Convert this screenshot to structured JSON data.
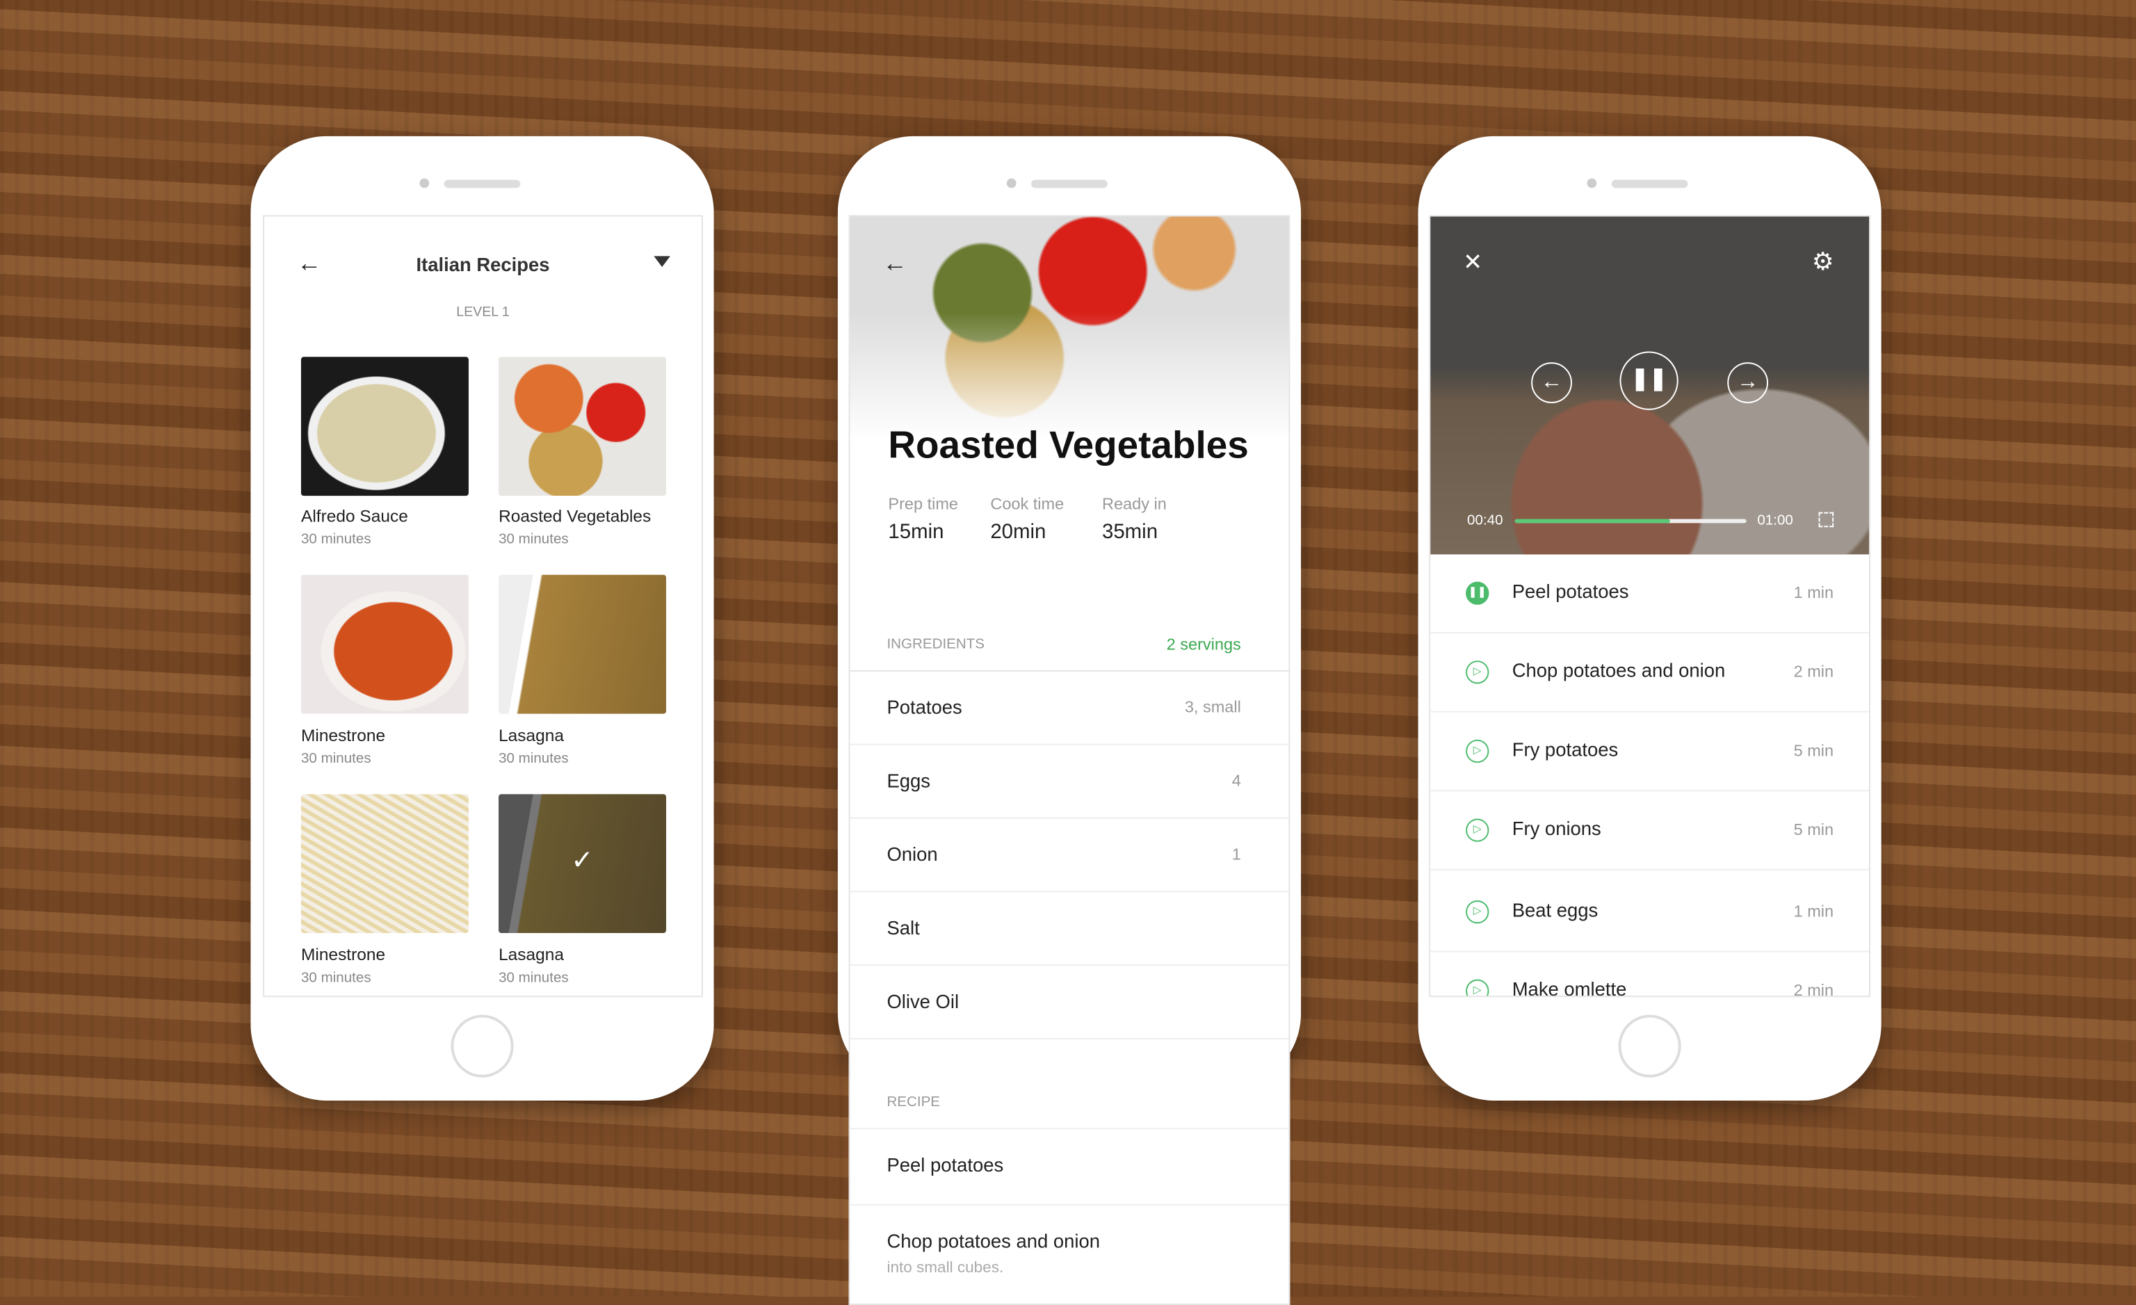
{
  "list_screen": {
    "title": "Italian Recipes",
    "level": "LEVEL 1",
    "recipes": [
      {
        "name": "Alfredo Sauce",
        "time": "30 minutes"
      },
      {
        "name": "Roasted Vegetables",
        "time": "30 minutes"
      },
      {
        "name": "Minestrone",
        "time": "30 minutes"
      },
      {
        "name": "Lasagna",
        "time": "30 minutes"
      },
      {
        "name": "Minestrone",
        "time": "30 minutes"
      },
      {
        "name": "Lasagna",
        "time": "30 minutes",
        "completed": true
      }
    ]
  },
  "detail_screen": {
    "title": "Roasted Vegetables",
    "stats": [
      {
        "label": "Prep time",
        "value": "15min"
      },
      {
        "label": "Cook time",
        "value": "20min"
      },
      {
        "label": "Ready in",
        "value": "35min"
      }
    ],
    "ingredients_header": "INGREDIENTS",
    "servings": "2 servings",
    "ingredients": [
      {
        "name": "Potatoes",
        "qty": "3, small"
      },
      {
        "name": "Eggs",
        "qty": "4"
      },
      {
        "name": "Onion",
        "qty": "1"
      },
      {
        "name": "Salt",
        "qty": ""
      },
      {
        "name": "Olive Oil",
        "qty": ""
      }
    ],
    "recipe_header": "RECIPE",
    "recipe_steps": [
      {
        "title": "Peel potatoes",
        "note": ""
      },
      {
        "title": "Chop potatoes and onion",
        "note": "into small cubes."
      }
    ]
  },
  "player_screen": {
    "current_time": "00:40",
    "total_time": "01:00",
    "progress": 0.67,
    "steps": [
      {
        "title": "Peel potatoes",
        "duration": "1 min",
        "state": "playing"
      },
      {
        "title": "Chop potatoes and onion",
        "duration": "2 min",
        "state": "idle"
      },
      {
        "title": "Fry potatoes",
        "duration": "5 min",
        "state": "idle"
      },
      {
        "title": "Fry onions",
        "duration": "5 min",
        "state": "idle"
      },
      {
        "title": "Beat eggs",
        "duration": "1 min",
        "state": "idle"
      },
      {
        "title": "Make omlette",
        "duration": "2 min",
        "state": "idle"
      }
    ]
  },
  "colors": {
    "accent": "#4cbb6c"
  }
}
